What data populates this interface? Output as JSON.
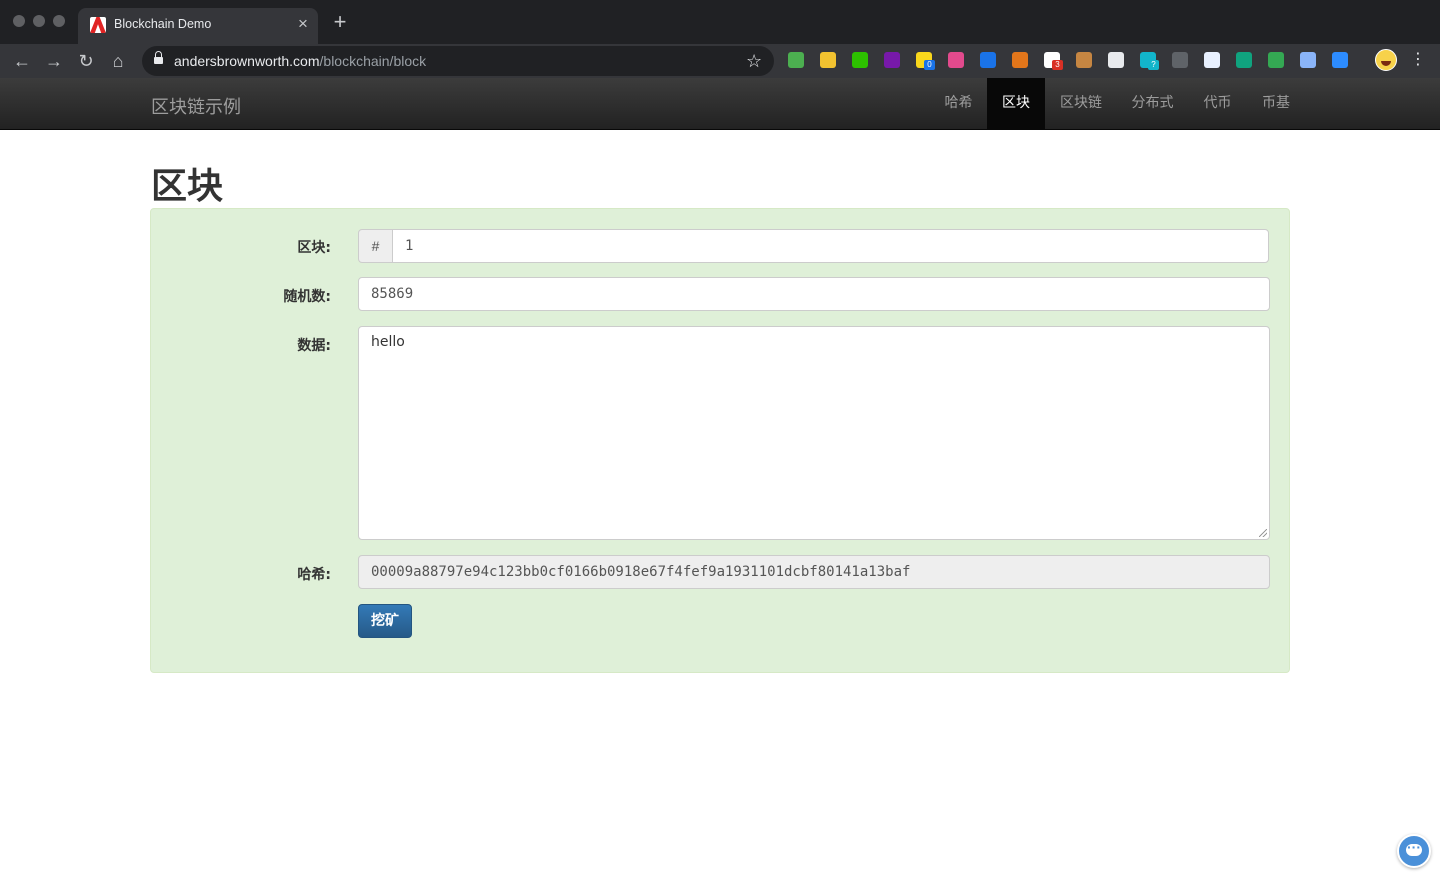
{
  "browser": {
    "tab_title": "Blockchain Demo",
    "tab_favicon": "adobe-icon",
    "url_host": "andersbrownworth.com",
    "url_path": "/blockchain/block",
    "extensions": [
      {
        "name": "extension-google-drive-icon",
        "color": "#4caf50"
      },
      {
        "name": "extension-yellow-bird-icon",
        "color": "#f2c230"
      },
      {
        "name": "extension-wechat-icon",
        "color": "#2dc100"
      },
      {
        "name": "extension-onenote-icon",
        "color": "#7719aa"
      },
      {
        "name": "extension-sticky-note-icon",
        "color": "#f9d71c",
        "badge": "0",
        "badge_color": "#1a73e8"
      },
      {
        "name": "extension-grid-icon",
        "color": "#e24a8d"
      },
      {
        "name": "extension-translate-icon",
        "color": "#1a73e8"
      },
      {
        "name": "extension-metamask-icon",
        "color": "#e2761b"
      },
      {
        "name": "extension-terminal-icon",
        "color": "#ffffff",
        "badge": "3",
        "badge_color": "#d93025"
      },
      {
        "name": "extension-cookie-icon",
        "color": "#c68642"
      },
      {
        "name": "extension-pen-icon",
        "color": "#e8eaed"
      },
      {
        "name": "extension-search-q-icon",
        "color": "#12b5cb",
        "badge": "?",
        "badge_color": "#12b5cb"
      },
      {
        "name": "extension-eye-icon",
        "color": "#5f6368"
      },
      {
        "name": "extension-code-icon",
        "color": "#e8f0fe"
      },
      {
        "name": "extension-chatgpt-icon",
        "color": "#10a37f"
      },
      {
        "name": "extension-green-square-icon",
        "color": "#34a853"
      },
      {
        "name": "extension-messenger-icon",
        "color": "#8ab4f8"
      },
      {
        "name": "extension-zoom-icon",
        "color": "#2d8cff"
      }
    ]
  },
  "site": {
    "brand": "区块链示例",
    "nav": [
      {
        "label": "哈希",
        "active": false
      },
      {
        "label": "区块",
        "active": true
      },
      {
        "label": "区块链",
        "active": false
      },
      {
        "label": "分布式",
        "active": false
      },
      {
        "label": "代币",
        "active": false
      },
      {
        "label": "币基",
        "active": false
      }
    ]
  },
  "page": {
    "title": "区块",
    "block_label": "区块:",
    "block_prefix": "#",
    "block_value": "1",
    "nonce_label": "随机数:",
    "nonce_value": "85869",
    "data_label": "数据:",
    "data_value": "hello",
    "hash_label": "哈希:",
    "hash_value": "00009a88797e94c123bb0cf0166b0918e67f4fef9a1931101dcbf80141a13baf",
    "mine_button": "挖矿",
    "panel_color": "#dff0d8"
  }
}
